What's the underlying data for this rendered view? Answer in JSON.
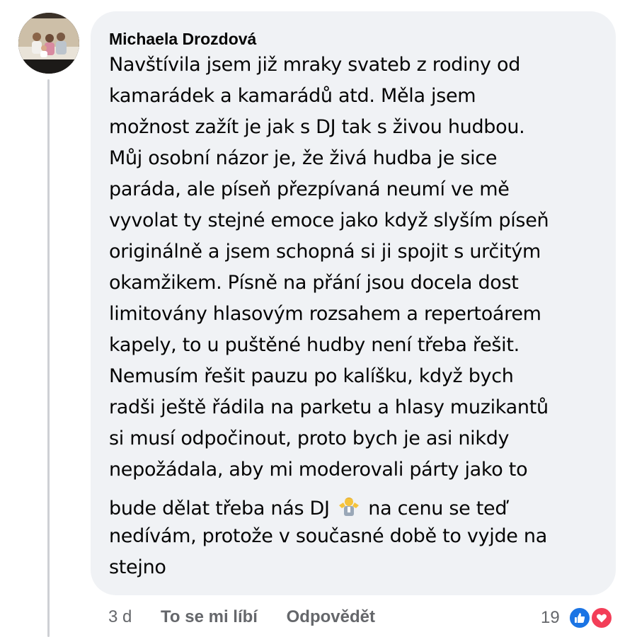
{
  "comment": {
    "author": "Michaela Drozdová",
    "lines": [
      "Navštívila jsem již mraky svateb z rodiny od",
      "kamarádek a kamarádů atd. Měla jsem",
      "možnost zažít je jak s DJ tak s živou hudbou.",
      "Můj osobní názor je, že živá hudba je sice",
      "paráda, ale píseň přezpívaná neumí ve mě",
      "vyvolat ty stejné emoce jako když slyším píseň",
      "originálně a jsem schopná si ji spojit s určitým",
      "okamžikem. Písně na přání jsou docela dost",
      "limitovány hlasovým rozsahem a repertoárem",
      "kapely, to u puštěné hudby není třeba řešit.",
      "Nemusím řešit pauzu po kalíšku, když bych",
      "radši ještě řádila na parketu a hlasy muzikantů",
      "si musí odpočinout, proto bych je asi nikdy",
      "nepožádala, aby mi moderovali párty jako to"
    ],
    "emoji_line_before": "bude dělat třeba nás DJ",
    "emoji_icon": "shrug-emoji-icon",
    "emoji_line_after": "na cenu se teď",
    "closing_lines": [
      "nedívám, protože v současné době to vyjde na",
      "stejno"
    ]
  },
  "actions": {
    "time": "3 d",
    "like_label": "To se mi líbí",
    "reply_label": "Odpovědět"
  },
  "reactions": {
    "count": "19",
    "icons": [
      "like-icon",
      "love-icon"
    ],
    "colors": {
      "like": "#1b74e4",
      "love": "#f33e58"
    }
  }
}
